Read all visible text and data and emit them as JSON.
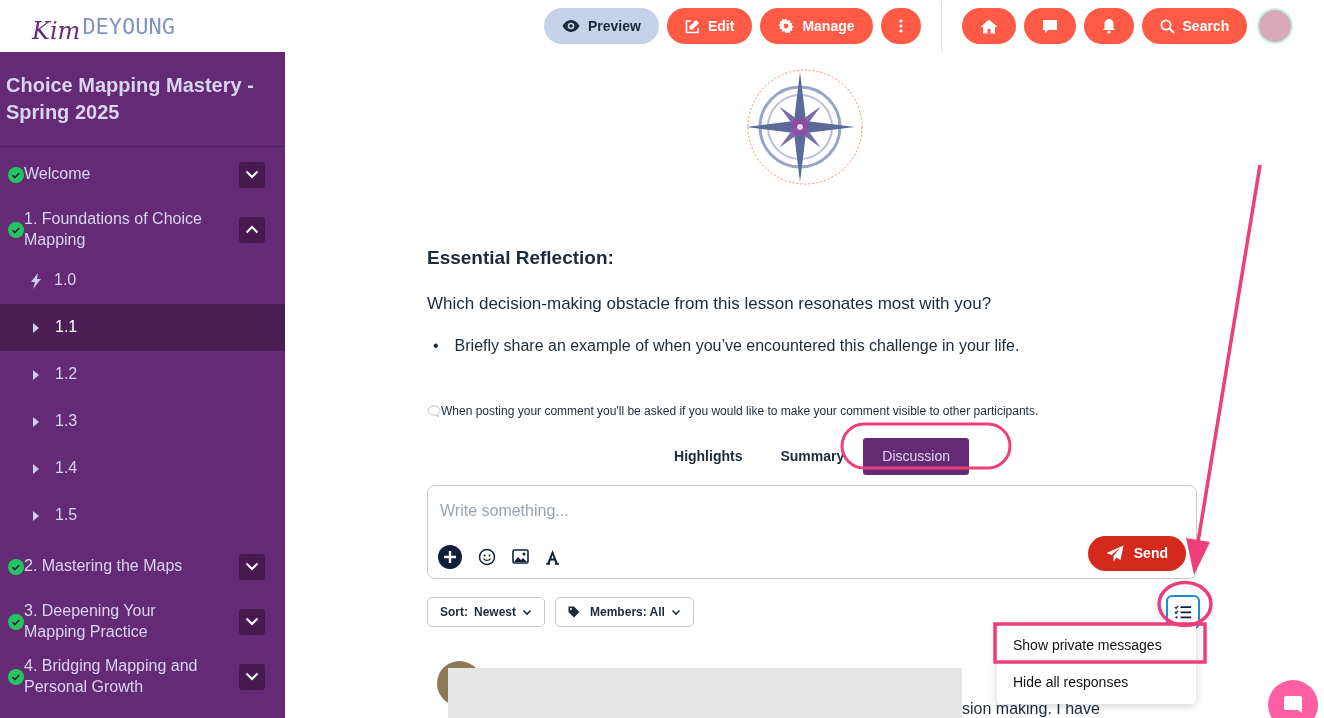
{
  "header": {
    "logo": {
      "script": "Kim",
      "word": "DEYOUNG"
    },
    "buttons": [
      {
        "label": "Preview",
        "kind": "secondary"
      },
      {
        "label": "Edit",
        "kind": "primary"
      },
      {
        "label": "Manage",
        "kind": "primary"
      },
      {
        "kind": "primary"
      },
      {
        "kind": "primary"
      },
      {
        "kind": "primary"
      },
      {
        "kind": "primary"
      },
      {
        "label": "Search",
        "kind": "primary"
      }
    ]
  },
  "sidebar": {
    "title": "Choice Mapping Mastery - Spring 2025",
    "items": [
      {
        "label": "Welcome",
        "complete": true,
        "expanded": false
      },
      {
        "label": "1. Foundations of Choice Mapping",
        "complete": true,
        "expanded": true,
        "children": [
          {
            "label": "1.0",
            "kind": "quiz",
            "selected": false
          },
          {
            "label": "1.1",
            "kind": "lesson",
            "selected": true
          },
          {
            "label": "1.2",
            "kind": "lesson",
            "selected": false
          },
          {
            "label": "1.3",
            "kind": "lesson",
            "selected": false
          },
          {
            "label": "1.4",
            "kind": "lesson",
            "selected": false
          },
          {
            "label": "1.5",
            "kind": "lesson",
            "selected": false
          }
        ]
      },
      {
        "label": "2. Mastering the Maps",
        "complete": true,
        "expanded": false
      },
      {
        "label": "3. Deepening Your Mapping Practice",
        "complete": true,
        "expanded": false
      },
      {
        "label": "4. Bridging Mapping and Personal Growth",
        "complete": true,
        "expanded": false
      }
    ]
  },
  "lesson": {
    "heading": "Essential Reflection:",
    "question": "Which decision-making obstacle from this lesson resonates most with you?",
    "bullets": [
      {
        "marker": "•",
        "text": "Briefly share an example of when you’ve encountered this challenge in your life."
      }
    ],
    "note": "When posting your comment you'll be asked if you would like to make your comment visible to other participants."
  },
  "tabs": [
    {
      "label": "Highlights",
      "selected": false
    },
    {
      "label": "Summary",
      "selected": false
    },
    {
      "label": "Discussion",
      "selected": true
    }
  ],
  "composer": {
    "placeholder": "Write something...",
    "send": "Send"
  },
  "filters": {
    "sort": {
      "label": "Sort:",
      "value": "Newest"
    },
    "members": "Members: All"
  },
  "menu": {
    "open": true,
    "items": [
      {
        "label": "Show private messages"
      },
      {
        "label": "Hide all responses"
      }
    ]
  },
  "comment": {
    "snippet": "sion making. I have"
  }
}
